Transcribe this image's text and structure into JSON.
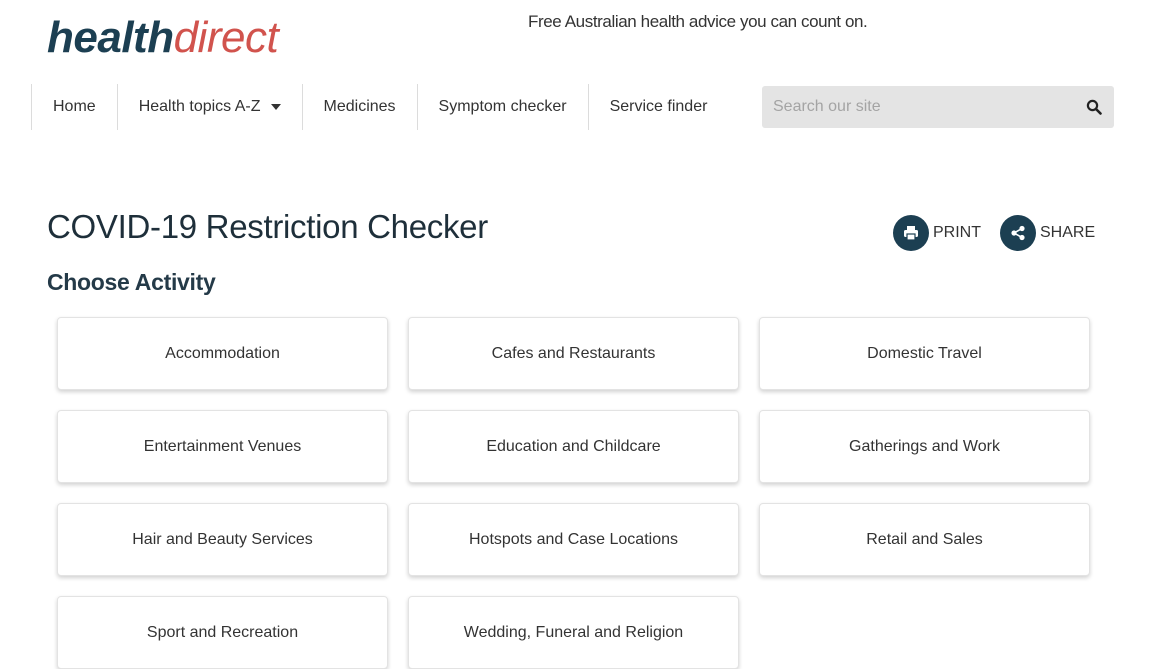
{
  "brand": {
    "part1": "health",
    "part2": "direct"
  },
  "tagline": "Free Australian health advice you can count on.",
  "nav": {
    "items": [
      {
        "label": "Home"
      },
      {
        "label": "Health topics A-Z",
        "dropdown": true
      },
      {
        "label": "Medicines"
      },
      {
        "label": "Symptom checker"
      },
      {
        "label": "Service finder"
      }
    ]
  },
  "search": {
    "placeholder": "Search our site",
    "value": ""
  },
  "page": {
    "title": "COVID-19 Restriction Checker",
    "subtitle": "Choose Activity"
  },
  "actions": {
    "print_label": "PRINT",
    "share_label": "SHARE"
  },
  "activities": [
    "Accommodation",
    "Cafes and Restaurants",
    "Domestic Travel",
    "Entertainment Venues",
    "Education and Childcare",
    "Gatherings and Work",
    "Hair and Beauty Services",
    "Hotspots and Case Locations",
    "Retail and Sales",
    "Sport and Recreation",
    "Wedding, Funeral and Religion"
  ],
  "icons": {
    "search": "search-icon",
    "print": "print-icon",
    "share": "share-icon",
    "dropdown": "chevron-down-icon"
  },
  "colors": {
    "brand_dark": "#1c3f52",
    "brand_red": "#d1534d",
    "search_bg": "#e4e4e4"
  }
}
